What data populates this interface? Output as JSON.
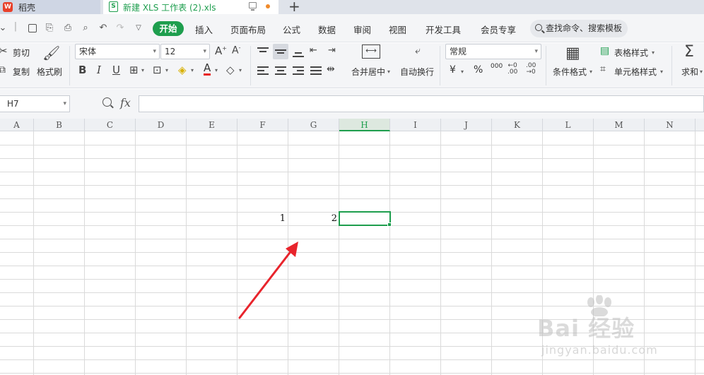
{
  "tabs": {
    "daoke": "稻壳",
    "file": "新建 XLS 工作表 (2).xls",
    "add": "+",
    "file_icon_letter": "S",
    "daoke_icon_letter": "W"
  },
  "menu": {
    "start": "开始",
    "items": [
      "插入",
      "页面布局",
      "公式",
      "数据",
      "审阅",
      "视图",
      "开发工具",
      "会员专享"
    ],
    "search_placeholder": "查找命令、搜索模板"
  },
  "ribbon": {
    "cut": "剪切",
    "copy": "复制",
    "format_painter": "格式刷",
    "font_name": "宋体",
    "font_size": "12",
    "merge_center": "合并居中",
    "wrap_text": "自动换行",
    "number_format": "常规",
    "conditional_format": "条件格式",
    "table_style": "表格样式",
    "cell_style": "单元格样式",
    "sum": "求和",
    "currency_symbol": "¥",
    "percent_symbol": "%",
    "thousands": "000"
  },
  "formula_bar": {
    "cell_ref": "H7",
    "fx": "fx",
    "formula": ""
  },
  "grid": {
    "columns": [
      "A",
      "B",
      "C",
      "D",
      "E",
      "F",
      "G",
      "H",
      "I",
      "J",
      "K",
      "L",
      "M",
      "N"
    ],
    "active_column": "H",
    "cells": [
      {
        "ref": "F7",
        "value": "1"
      },
      {
        "ref": "G7",
        "value": "2"
      }
    ]
  },
  "watermark": {
    "line1": "Bai 经验",
    "line2": "jingyan.baidu.com"
  },
  "colors": {
    "accent": "#1e9e4e",
    "arrow": "#e8242c"
  }
}
